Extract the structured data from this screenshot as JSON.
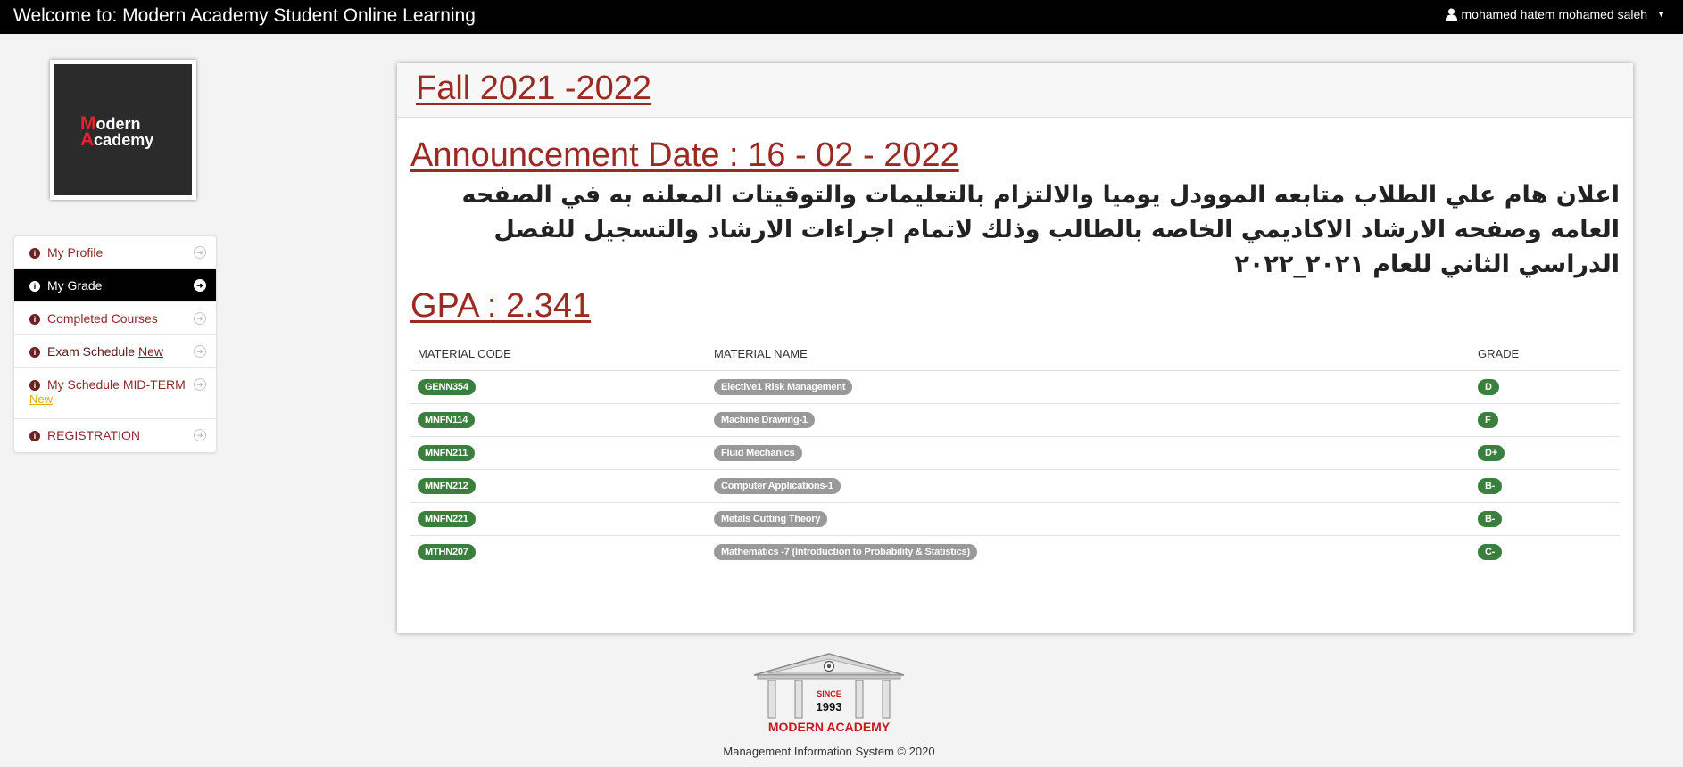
{
  "header": {
    "title": "Welcome to: Modern Academy Student Online Learning",
    "user_name": "mohamed hatem mohamed saleh"
  },
  "logo": {
    "line1_first": "M",
    "line1_rest": "odern",
    "line2_first": "A",
    "line2_rest": "cademy"
  },
  "sidebar": {
    "items": [
      {
        "label": "My Profile"
      },
      {
        "label": "My Grade"
      },
      {
        "label": "Completed Courses"
      },
      {
        "label": "Exam Schedule",
        "badge": "New"
      },
      {
        "label": "My Schedule MID-TERM",
        "badge": "New"
      },
      {
        "label": "REGISTRATION"
      }
    ]
  },
  "main": {
    "semester": "Fall 2021 -2022",
    "announcement_date": "Announcement Date : 16 - 02 - 2022",
    "announcement_text": "اعلان هام علي الطلاب متابعه الموودل يوميا والالتزام بالتعليمات والتوقيتات المعلنه به في الصفحه العامه وصفحه الارشاد الاكاديمي الخاصه بالطالب وذلك لاتمام اجراءات الارشاد والتسجيل للفصل الدراسي الثاني للعام ٢٠٢١_٢٠٢٢",
    "gpa": "GPA : 2.341",
    "table": {
      "headers": [
        "MATERIAL CODE",
        "MATERIAL NAME",
        "GRADE"
      ],
      "rows": [
        {
          "code": "GENN354",
          "name": "Elective1 Risk Management",
          "grade": "D"
        },
        {
          "code": "MNFN114",
          "name": "Machine Drawing-1",
          "grade": "F"
        },
        {
          "code": "MNFN211",
          "name": "Fluid Mechanics",
          "grade": "D+"
        },
        {
          "code": "MNFN212",
          "name": "Computer Applications-1",
          "grade": "B-"
        },
        {
          "code": "MNFN221",
          "name": "Metals Cutting Theory",
          "grade": "B-"
        },
        {
          "code": "MTHN207",
          "name": "Mathematics -7 (Introduction to Probability & Statistics)",
          "grade": "C-"
        }
      ]
    }
  },
  "footer": {
    "logo_since": "SINCE",
    "logo_year": "1993",
    "logo_name": "MODERN ACADEMY",
    "copyright": "Management Information System © 2020"
  },
  "colors": {
    "accent": "#9b2b22",
    "badge_green": "#3a7f3e",
    "badge_gray": "#999999"
  }
}
